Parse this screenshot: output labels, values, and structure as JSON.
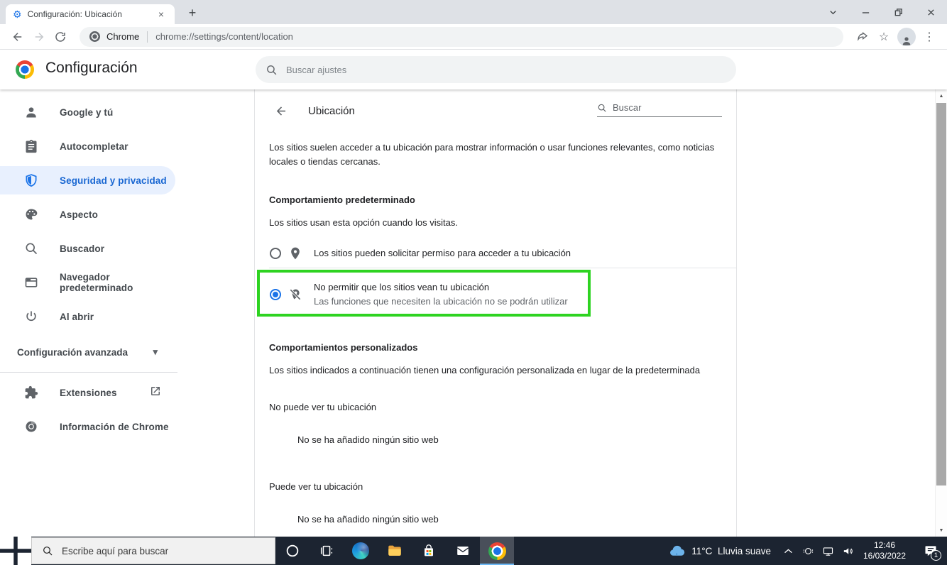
{
  "browser": {
    "tab_title": "Configuración: Ubicación",
    "url_host_label": "Chrome",
    "url": "chrome://settings/content/location"
  },
  "header": {
    "title": "Configuración",
    "search_placeholder": "Buscar ajustes"
  },
  "sidebar": {
    "items": [
      {
        "label": "Google y tú",
        "icon": "person-icon",
        "selected": false
      },
      {
        "label": "Autocompletar",
        "icon": "clipboard-icon",
        "selected": false
      },
      {
        "label": "Seguridad y privacidad",
        "icon": "shield-icon",
        "selected": true
      },
      {
        "label": "Aspecto",
        "icon": "palette-icon",
        "selected": false
      },
      {
        "label": "Buscador",
        "icon": "search-icon",
        "selected": false
      },
      {
        "label": "Navegador predeterminado",
        "icon": "browser-icon",
        "selected": false
      },
      {
        "label": "Al abrir",
        "icon": "power-icon",
        "selected": false
      }
    ],
    "advanced_label": "Configuración avanzada",
    "extensions_label": "Extensiones",
    "about_label": "Información de Chrome"
  },
  "content": {
    "title": "Ubicación",
    "search_placeholder": "Buscar",
    "intro": "Los sitios suelen acceder a tu ubicación para mostrar información o usar funciones relevantes, como noticias locales o tiendas cercanas.",
    "default_behavior": {
      "title": "Comportamiento predeterminado",
      "subtitle": "Los sitios usan esta opción cuando los visitas.",
      "options": [
        {
          "label": "Los sitios pueden solicitar permiso para acceder a tu ubicación",
          "selected": false
        },
        {
          "label": "No permitir que los sitios vean tu ubicación",
          "sublabel": "Las funciones que necesiten la ubicación no se podrán utilizar",
          "selected": true,
          "highlighted": true
        }
      ]
    },
    "custom_behaviors": {
      "title": "Comportamientos personalizados",
      "subtitle": "Los sitios indicados a continuación tienen una configuración personalizada en lugar de la predeterminada",
      "groups": [
        {
          "label": "No puede ver tu ubicación",
          "empty_text": "No se ha añadido ningún sitio web"
        },
        {
          "label": "Puede ver tu ubicación",
          "empty_text": "No se ha añadido ningún sitio web"
        }
      ]
    }
  },
  "taskbar": {
    "search_placeholder": "Escribe aquí para buscar",
    "weather_temp": "11°C",
    "weather_condition": "Lluvia suave",
    "clock_time": "12:46",
    "clock_date": "16/03/2022",
    "notification_count": "1"
  },
  "icons": {
    "tab_gear": "⚙",
    "new_tab_plus": "+",
    "tab_close": "×",
    "star": "☆",
    "menu_dots": "⋮",
    "caret_down": "▾",
    "scroll_up": "▲",
    "scroll_down": "▼"
  },
  "colors": {
    "accent_blue": "#1a73e8",
    "selected_item_bg": "#e8f0fe",
    "annotation_green": "#2ed321",
    "taskbar_bg": "#1c2431",
    "tabstrip_bg": "#dee1e6"
  }
}
